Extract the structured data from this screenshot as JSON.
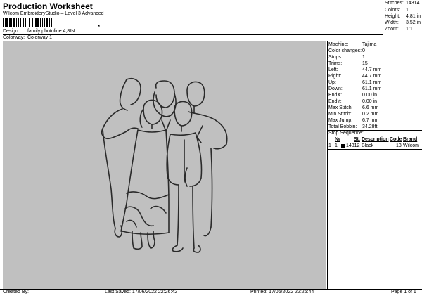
{
  "header": {
    "title": "Production Worksheet",
    "subtitle": "Wilcom EmbroideryStudio – Level 3 Advanced",
    "barcode_comma": ",",
    "design_label": "Design:",
    "design_value": "family photoline 4,8IN",
    "colorway_label": "Colorway:",
    "colorway_value": "Colorway 1"
  },
  "summary": [
    {
      "label": "Stitches:",
      "value": "14314"
    },
    {
      "label": "Colors:",
      "value": "1"
    },
    {
      "label": "Height:",
      "value": "4.81 in"
    },
    {
      "label": "Width:",
      "value": "3.52 in"
    },
    {
      "label": "Zoom:",
      "value": "1:1"
    }
  ],
  "info": [
    {
      "label": "Machine:",
      "value": "Tajima"
    },
    {
      "label": "Color changes:",
      "value": "0"
    },
    {
      "label": "Stops:",
      "value": "1"
    },
    {
      "label": "Trims:",
      "value": "15"
    },
    {
      "label": "Left:",
      "value": "44.7 mm"
    },
    {
      "label": "Right:",
      "value": "44.7 mm"
    },
    {
      "label": "Up:",
      "value": "61.1 mm"
    },
    {
      "label": "Down:",
      "value": "61.1 mm"
    },
    {
      "label": "EndX:",
      "value": "0.00 in"
    },
    {
      "label": "EndY:",
      "value": "0.00 in"
    },
    {
      "label": "Max Stitch:",
      "value": "6.6 mm"
    },
    {
      "label": "Min Stitch:",
      "value": "0.2 mm"
    },
    {
      "label": "Max Jump:",
      "value": "6.7 mm"
    },
    {
      "label": "Total Bobbin:",
      "value": "34.28ft"
    }
  ],
  "stop_sequence": {
    "title": "Stop Sequence:",
    "columns": [
      "№",
      "St.",
      "Description",
      "Code",
      "Brand"
    ],
    "rows": [
      {
        "index": "1",
        "num": "1",
        "stitches": "14312",
        "description": "Black",
        "code": "13",
        "brand": "Wilcom",
        "swatch": "#000000"
      }
    ]
  },
  "footer": {
    "created_by": "Created By:",
    "last_saved": "Last Saved: 17/06/2022 22:26:42",
    "printed": "Printed: 17/06/2022 22:26:44",
    "page": "Page 1 of 1"
  }
}
